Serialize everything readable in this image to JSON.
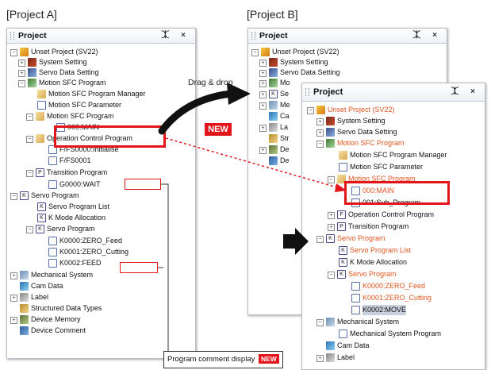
{
  "captions": {
    "project_a": "[Project A]",
    "project_b": "[Project B]",
    "drag_drop": "Drag & drop",
    "new_badge": "NEW",
    "program_comment_display": "Program comment display",
    "new_badge_small": "NEW"
  },
  "panel_a": {
    "title": "Project",
    "header_icons": "⯰ ×",
    "tree": [
      {
        "label": "Unset Project (SV22)"
      },
      {
        "label": "System Setting"
      },
      {
        "label": "Servo Data Setting"
      },
      {
        "label": "Motion SFC Program"
      },
      {
        "label": "Motion SFC Program Manager"
      },
      {
        "label": "Motion SFC Parameter"
      },
      {
        "label": "Motion SFC Program"
      },
      {
        "label": "000:MAIN"
      },
      {
        "label": "Operation Control Program"
      },
      {
        "label": "F/FS0000:"
      },
      {
        "label": "Initialise"
      },
      {
        "label": "F/FS0001"
      },
      {
        "label": "Transition Program"
      },
      {
        "label": "G0000:WAIT"
      },
      {
        "label": "Servo Program"
      },
      {
        "label": "Servo Program List"
      },
      {
        "label": "K Mode Allocation"
      },
      {
        "label": "Servo Program"
      },
      {
        "label": "K0000:ZERO_Feed"
      },
      {
        "label": "K0001:"
      },
      {
        "label": "ZERO_Cutting"
      },
      {
        "label": "K0002:FEED"
      },
      {
        "label": "Mechanical System"
      },
      {
        "label": "Cam Data"
      },
      {
        "label": "Label"
      },
      {
        "label": "Structured Data Types"
      },
      {
        "label": "Device Memory"
      },
      {
        "label": "Device Comment"
      }
    ]
  },
  "panel_b_back": {
    "title": "Project",
    "header_icons": "⯰ ×",
    "tree": [
      {
        "label": "Unset Project (SV22)"
      },
      {
        "label": "System Setting"
      },
      {
        "label": "Servo Data Setting"
      },
      {
        "label": "Mo"
      },
      {
        "label": "Se"
      },
      {
        "label": "Me"
      },
      {
        "label": "Ca"
      },
      {
        "label": "La"
      },
      {
        "label": "Str"
      },
      {
        "label": "De"
      },
      {
        "label": "De"
      }
    ]
  },
  "panel_b_front": {
    "title": "Project",
    "header_icons": "⯰ ×",
    "tree": [
      {
        "label": "Unset Project (SV22)"
      },
      {
        "label": "System Setting"
      },
      {
        "label": "Servo Data Setting"
      },
      {
        "label": "Motion SFC Program"
      },
      {
        "label": "Motion SFC Program Manager"
      },
      {
        "label": "Motion SFC Parameter"
      },
      {
        "label": "Motion SFC Program"
      },
      {
        "label": "000:MAIN"
      },
      {
        "label": "001:Sub_Program"
      },
      {
        "label": "Operation Control Program"
      },
      {
        "label": "Transition Program"
      },
      {
        "label": "Servo Program"
      },
      {
        "label": "Servo Program List"
      },
      {
        "label": "K Mode Allocation"
      },
      {
        "label": "Servo Program"
      },
      {
        "label": "K0000:ZERO_Feed"
      },
      {
        "label": "K0001:ZERO_Cutting"
      },
      {
        "label": "K0002:MOVE"
      },
      {
        "label": "Mechanical System"
      },
      {
        "label": "Mechanical System Program"
      },
      {
        "label": "Cam Data"
      },
      {
        "label": "Label"
      }
    ]
  },
  "colors": {
    "accent_red": "#e2151b",
    "new_item_orange": "#e0551f",
    "selection": "#c8d0dd"
  }
}
